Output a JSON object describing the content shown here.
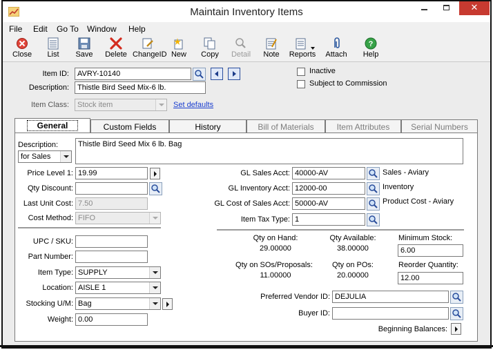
{
  "window": {
    "title": "Maintain Inventory Items",
    "close_glyph": "✕"
  },
  "menu": [
    "File",
    "Edit",
    "Go To",
    "Window",
    "Help"
  ],
  "toolbar": {
    "close": "Close",
    "list": "List",
    "save": "Save",
    "delete": "Delete",
    "changeid": "ChangeID",
    "new": "New",
    "copy": "Copy",
    "detail": "Detail",
    "note": "Note",
    "reports": "Reports",
    "attach": "Attach",
    "help": "Help"
  },
  "header": {
    "item_id_label": "Item ID:",
    "item_id": "AVRY-10140",
    "description_label": "Description:",
    "description": "Thistle Bird Seed Mix-6 lb.",
    "item_class_label": "Item Class:",
    "item_class": "Stock item",
    "set_defaults": "Set defaults",
    "inactive_label": "Inactive",
    "commission_label": "Subject to Commission"
  },
  "tabs": [
    "General",
    "Custom Fields",
    "History",
    "Bill of Materials",
    "Item Attributes",
    "Serial Numbers"
  ],
  "general": {
    "description_label": "Description:",
    "description_type": "for Sales",
    "long_description": "Thistle Bird Seed Mix 6 lb. Bag",
    "price_level_label": "Price Level 1:",
    "price_level": "19.99",
    "qty_discount_label": "Qty Discount:",
    "qty_discount": "",
    "last_unit_cost_label": "Last Unit Cost:",
    "last_unit_cost": "7.50",
    "cost_method_label": "Cost Method:",
    "cost_method": "FIFO",
    "gl_sales_label": "GL Sales Acct:",
    "gl_sales": "40000-AV",
    "gl_sales_desc": "Sales - Aviary",
    "gl_inventory_label": "GL Inventory Acct:",
    "gl_inventory": "12000-00",
    "gl_inventory_desc": "Inventory",
    "gl_cost_label": "GL Cost of Sales Acct:",
    "gl_cost": "50000-AV",
    "gl_cost_desc": "Product Cost - Aviary",
    "tax_type_label": "Item Tax Type:",
    "tax_type": "1",
    "upc_label": "UPC / SKU:",
    "upc": "",
    "part_number_label": "Part Number:",
    "part_number": "",
    "item_type_label": "Item Type:",
    "item_type": "SUPPLY",
    "location_label": "Location:",
    "location": "AISLE 1",
    "stocking_um_label": "Stocking U/M:",
    "stocking_um": "Bag",
    "weight_label": "Weight:",
    "weight": "0.00",
    "qty_on_hand_label": "Qty on Hand:",
    "qty_on_hand": "29.00000",
    "qty_available_label": "Qty Available:",
    "qty_available": "38.00000",
    "min_stock_label": "Minimum Stock:",
    "min_stock": "6.00",
    "qty_on_so_label": "Qty on SOs/Proposals:",
    "qty_on_so": "11.00000",
    "qty_on_po_label": "Qty on POs:",
    "qty_on_po": "20.00000",
    "reorder_label": "Reorder Quantity:",
    "reorder": "12.00",
    "vendor_label": "Preferred Vendor ID:",
    "vendor": "DEJULIA",
    "buyer_label": "Buyer ID:",
    "buyer": "",
    "beginning_balances_label": "Beginning Balances:"
  }
}
